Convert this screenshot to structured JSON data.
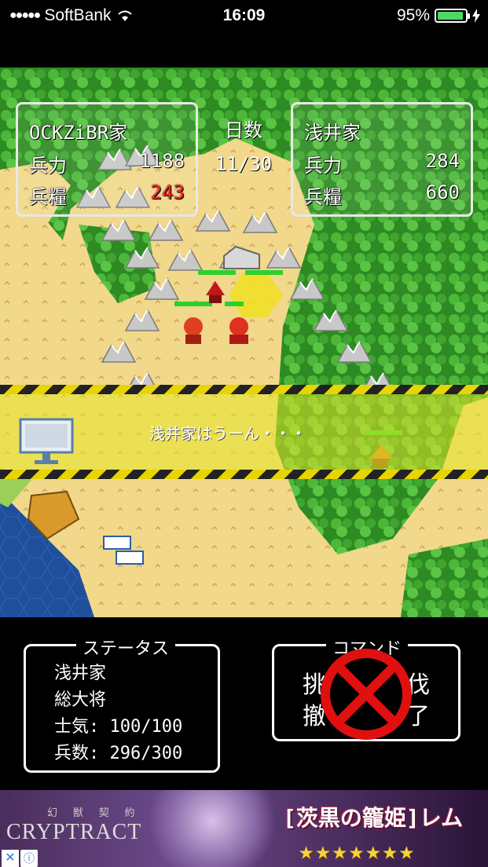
{
  "status_bar": {
    "signal": "●●●●●",
    "carrier": "SoftBank",
    "time": "16:09",
    "battery": "95%",
    "battery_level": 0.95
  },
  "hud": {
    "player": {
      "name": "OCKZiBR家",
      "troops_label": "兵力",
      "troops": "1188",
      "supply_label": "兵糧",
      "supply": "243"
    },
    "days": {
      "label": "日数",
      "value": "11/30"
    },
    "enemy": {
      "name": "浅井家",
      "troops_label": "兵力",
      "troops": "284",
      "supply_label": "兵糧",
      "supply": "660"
    }
  },
  "banner": {
    "message": "浅井家はうーん・・・"
  },
  "status_panel": {
    "title": "ステータス",
    "clan": "浅井家",
    "role": "総大将",
    "morale": "士気: 100/100",
    "soldiers": "兵数: 296/300"
  },
  "command_panel": {
    "title": "コマンド",
    "cmd1": "挑",
    "cmd2": "伐",
    "cmd3": "撤",
    "cmd4": "了"
  },
  "ad": {
    "small": "幻 獣 契 約",
    "brand": "CRYPTRACT",
    "title": "[茨黒の籠姫]レム",
    "stars": "★★★★★★★",
    "close": "✕",
    "info": "ⓘ"
  },
  "colors": {
    "grass": "#3a9a2a",
    "sand": "#f1d88a",
    "sea": "#1f4f9a",
    "accent_red": "#ff2020"
  }
}
